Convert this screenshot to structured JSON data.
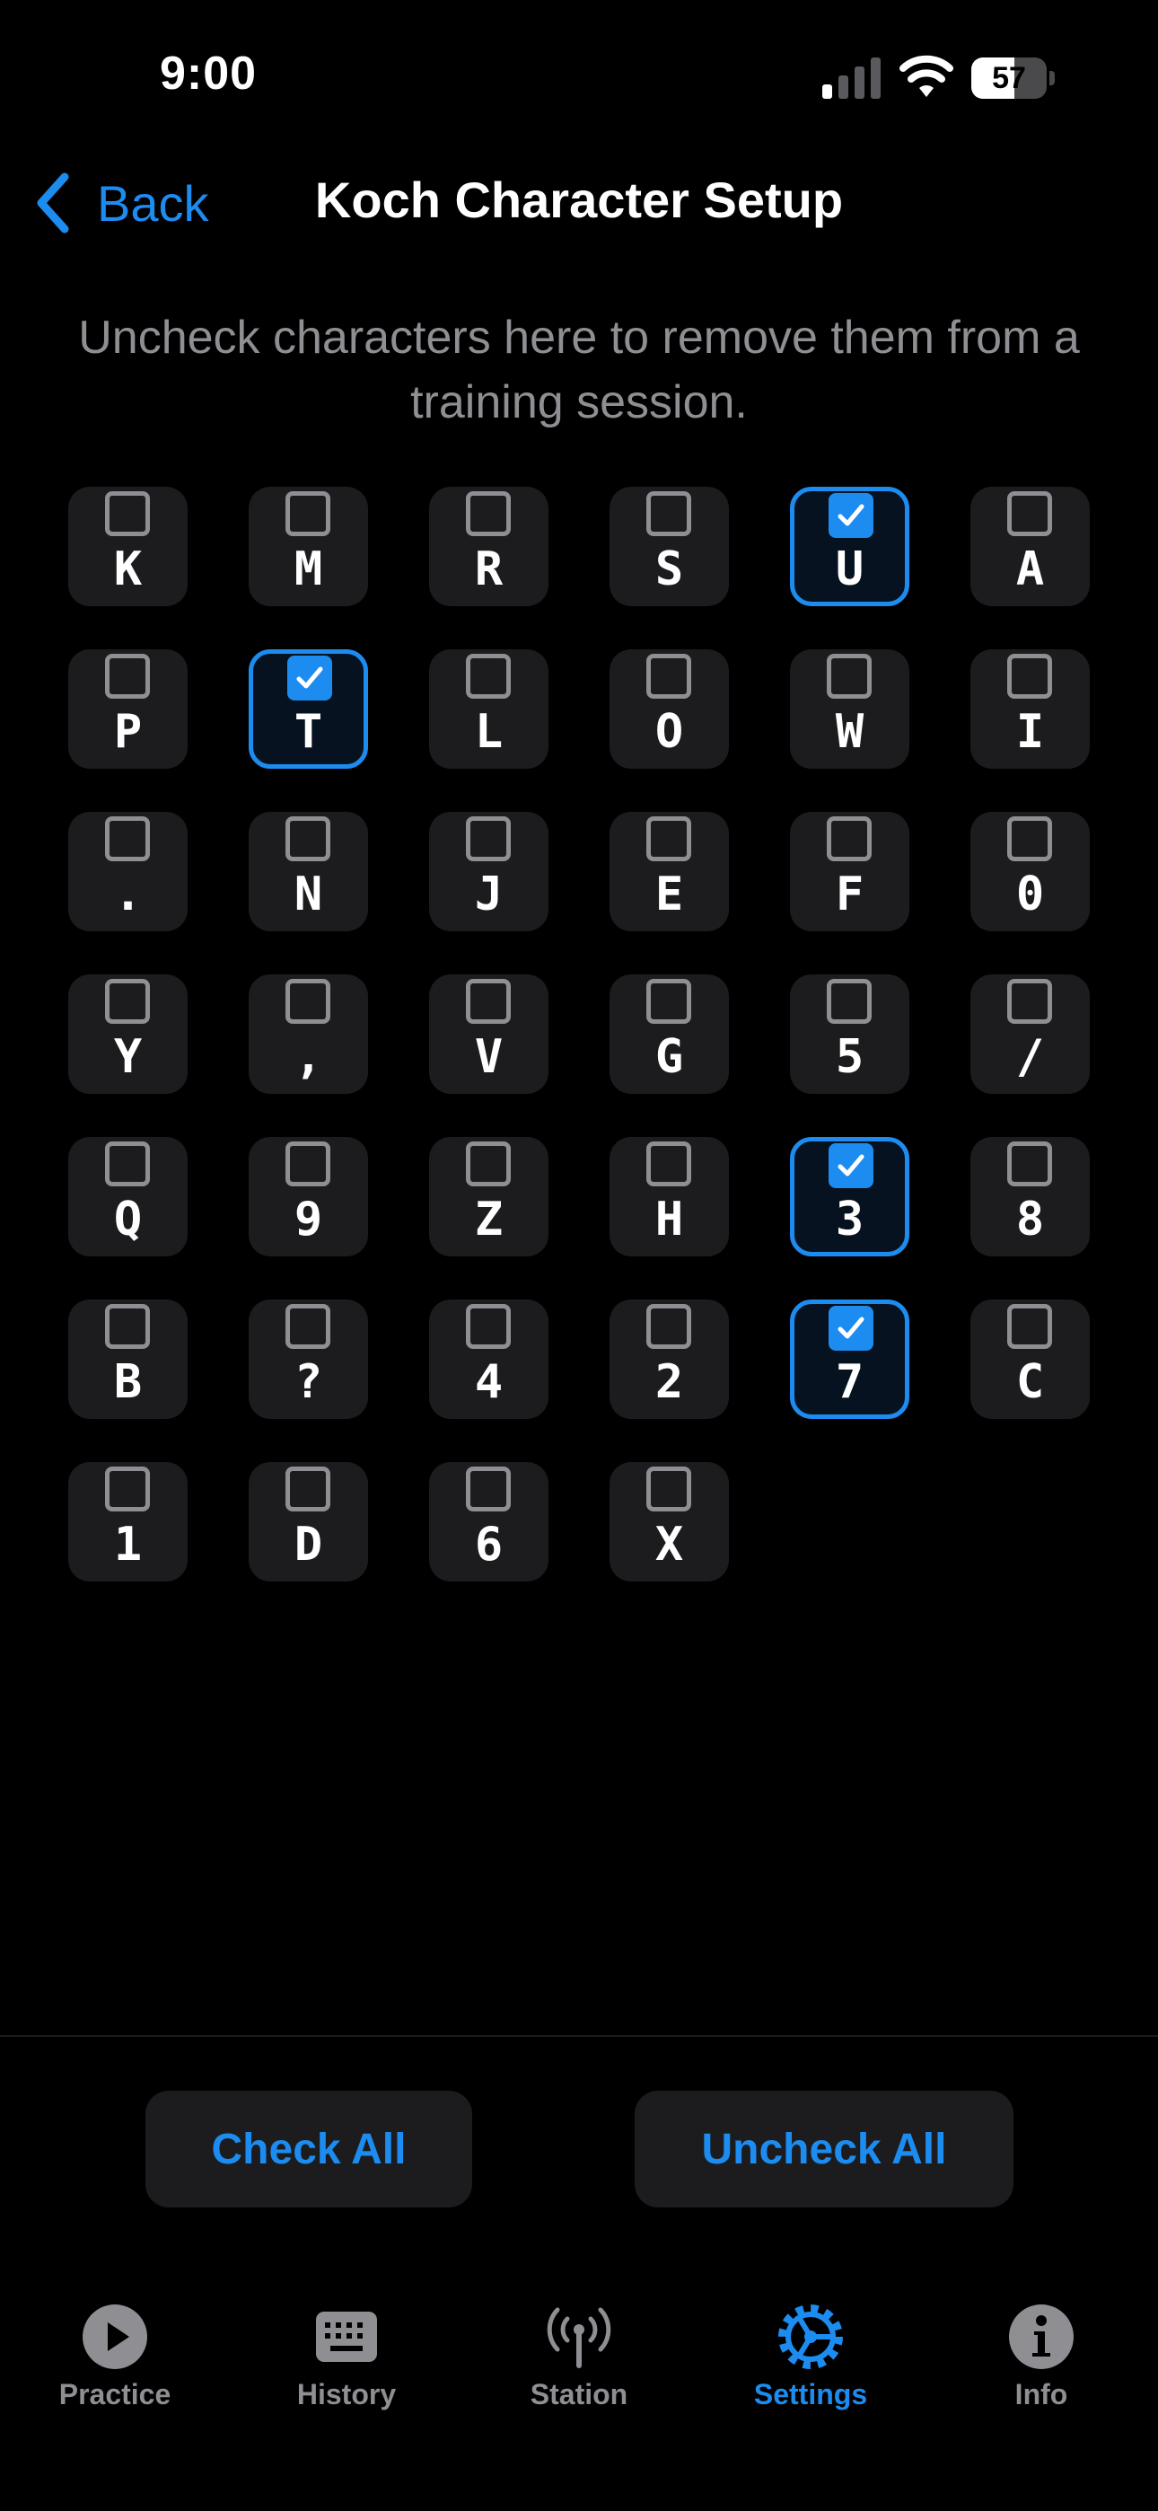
{
  "status_bar": {
    "time": "9:00",
    "battery_percent": "57",
    "battery_level": 0.57,
    "cell_signal_bars": 1,
    "icons": [
      "cell-signal-icon",
      "wifi-icon",
      "battery-icon"
    ]
  },
  "nav": {
    "back_label": "Back",
    "title": "Koch Character Setup"
  },
  "instructions": "Uncheck characters here to remove them from a training session.",
  "characters": [
    {
      "char": "K",
      "checked": false
    },
    {
      "char": "M",
      "checked": false
    },
    {
      "char": "R",
      "checked": false
    },
    {
      "char": "S",
      "checked": false
    },
    {
      "char": "U",
      "checked": true
    },
    {
      "char": "A",
      "checked": false
    },
    {
      "char": "P",
      "checked": false
    },
    {
      "char": "T",
      "checked": true
    },
    {
      "char": "L",
      "checked": false
    },
    {
      "char": "O",
      "checked": false
    },
    {
      "char": "W",
      "checked": false
    },
    {
      "char": "I",
      "checked": false
    },
    {
      "char": ".",
      "checked": false
    },
    {
      "char": "N",
      "checked": false
    },
    {
      "char": "J",
      "checked": false
    },
    {
      "char": "E",
      "checked": false
    },
    {
      "char": "F",
      "checked": false
    },
    {
      "char": "0",
      "checked": false
    },
    {
      "char": "Y",
      "checked": false
    },
    {
      "char": ",",
      "checked": false
    },
    {
      "char": "V",
      "checked": false
    },
    {
      "char": "G",
      "checked": false
    },
    {
      "char": "5",
      "checked": false
    },
    {
      "char": "/",
      "checked": false
    },
    {
      "char": "Q",
      "checked": false
    },
    {
      "char": "9",
      "checked": false
    },
    {
      "char": "Z",
      "checked": false
    },
    {
      "char": "H",
      "checked": false
    },
    {
      "char": "3",
      "checked": true
    },
    {
      "char": "8",
      "checked": false
    },
    {
      "char": "B",
      "checked": false
    },
    {
      "char": "?",
      "checked": false
    },
    {
      "char": "4",
      "checked": false
    },
    {
      "char": "2",
      "checked": false
    },
    {
      "char": "7",
      "checked": true
    },
    {
      "char": "C",
      "checked": false
    },
    {
      "char": "1",
      "checked": false
    },
    {
      "char": "D",
      "checked": false
    },
    {
      "char": "6",
      "checked": false
    },
    {
      "char": "X",
      "checked": false
    }
  ],
  "actions": {
    "check_all": "Check All",
    "uncheck_all": "Uncheck All"
  },
  "tabs": [
    {
      "label": "Practice",
      "icon": "play-circle-icon",
      "active": false
    },
    {
      "label": "History",
      "icon": "keyboard-icon",
      "active": false
    },
    {
      "label": "Station",
      "icon": "antenna-icon",
      "active": false
    },
    {
      "label": "Settings",
      "icon": "gear-icon",
      "active": true
    },
    {
      "label": "Info",
      "icon": "info-icon",
      "active": false
    }
  ],
  "colors": {
    "accent": "#1c8cf0",
    "background": "#000000",
    "tile": "#1c1c1e",
    "secondary_text": "#8e8e93"
  }
}
